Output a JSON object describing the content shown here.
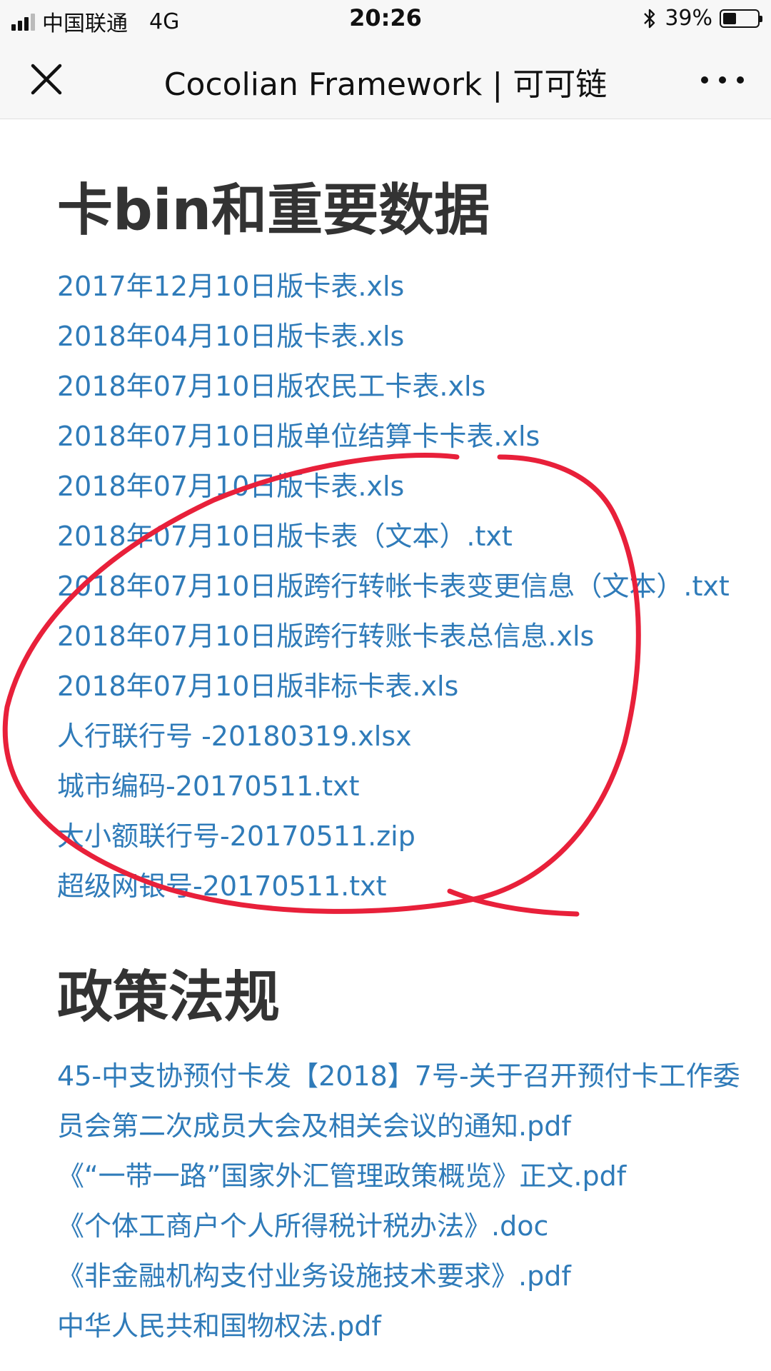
{
  "status_bar": {
    "carrier": "中国联通",
    "network": "4G",
    "time": "20:26",
    "battery_text": "39%",
    "battery_level": 0.39
  },
  "nav": {
    "title": "Cocolian Framework | 可可链"
  },
  "sections": [
    {
      "heading": "卡bin和重要数据",
      "items": [
        "2017年12月10日版卡表.xls",
        "2018年04月10日版卡表.xls",
        "2018年07月10日版农民工卡表.xls",
        "2018年07月10日版单位结算卡卡表.xls",
        "2018年07月10日版卡表.xls",
        "2018年07月10日版卡表（文本）.txt",
        "2018年07月10日版跨行转帐卡表变更信息（文本）.txt",
        "2018年07月10日版跨行转账卡表总信息.xls",
        "2018年07月10日版非标卡表.xls",
        "人行联行号 -20180319.xlsx",
        "城市编码-20170511.txt",
        "大小额联行号-20170511.zip",
        "超级网银号-20170511.txt"
      ]
    },
    {
      "heading": "政策法规",
      "items": [
        "45-中支协预付卡发【2018】7号-关于召开预付卡工作委员会第二次成员大会及相关会议的通知.pdf",
        "《“一带一路”国家外汇管理政策概览》正文.pdf",
        "《个体工商户个人所得税计税办法》.doc",
        "《非金融机构支付业务设施技术要求》.pdf",
        "中华人民共和国物权法.pdf"
      ]
    }
  ],
  "colors": {
    "link": "#2f7bb9",
    "heading": "#333333",
    "annotation": "#e8203a",
    "bar_bg": "#f7f7f7"
  },
  "icons": [
    "close-icon",
    "more-icon",
    "signal-icon",
    "bluetooth-icon",
    "battery-icon"
  ]
}
